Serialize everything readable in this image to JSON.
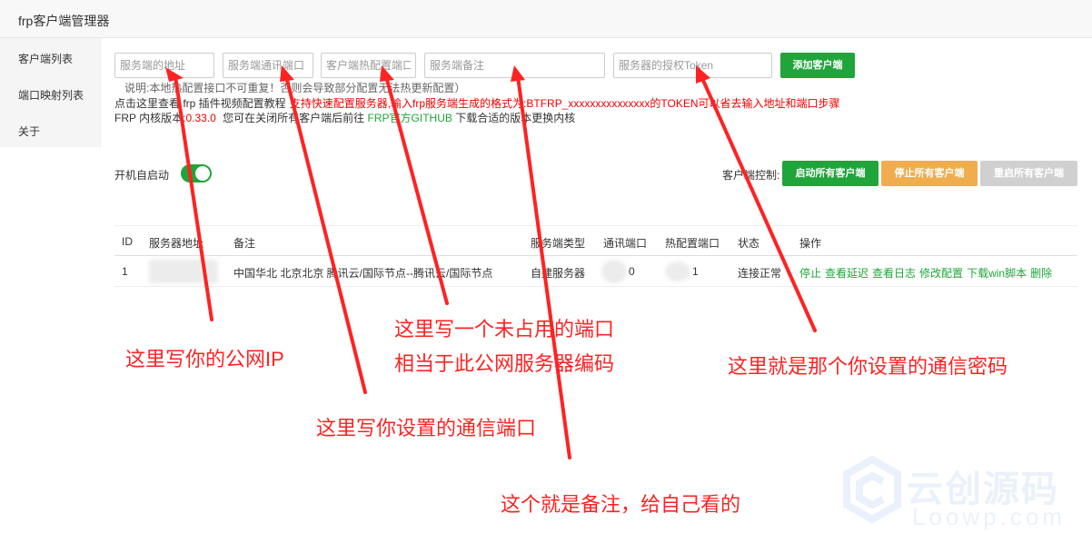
{
  "window": {
    "title": "frp客户端管理器"
  },
  "sidebar": {
    "items": [
      {
        "label": "客户端列表"
      },
      {
        "label": "端口映射列表"
      },
      {
        "label": "关于"
      }
    ]
  },
  "form": {
    "server_addr_placeholder": "服务端的地址",
    "server_port_placeholder": "服务端通讯端口",
    "client_port_placeholder": "客户端热配置端口",
    "remark_placeholder": "服务端备注",
    "token_placeholder": "服务器的授权Token",
    "add_button": "添加客户端"
  },
  "notes": {
    "line1": "说明:本地热配置接口不可重复！否则会导致部分配置无法热更新配置）",
    "line2_a": "点击这里查看 frp 插件视频配置教程",
    "line2_b": "支持快速配置服务器,输入frp服务端生成的格式为:BTFRP_xxxxxxxxxxxxxxx的TOKEN可以省去输入地址和端口步骤",
    "line3_a": "FRP 内核版本:",
    "line3_version": "0.33.0",
    "line3_b": "您可在关闭所有客户端后前往",
    "line3_link": "FRP官方GITHUB",
    "line3_c": "下载合适的版本更换内核"
  },
  "autostart": {
    "label": "开机自启动",
    "enabled": true
  },
  "control": {
    "label": "客户端控制:",
    "start_all": "启动所有客户端",
    "stop_all": "停止所有客户端",
    "restart_all": "重启所有客户端"
  },
  "table": {
    "headers": [
      "ID",
      "服务器地址",
      "备注",
      "服务端类型",
      "通讯端口",
      "热配置端口",
      "状态",
      "操作"
    ],
    "rows": [
      {
        "id": "1",
        "remark": "中国华北 北京北京 腾讯云/国际节点--腾讯云/国际节点",
        "server_type": "自建服务器",
        "port_suffix": "0",
        "hot_port_suffix": "1",
        "status": "连接正常",
        "actions": [
          "停止",
          "查看延迟",
          "查看日志",
          "修改配置",
          "下载win脚本",
          "删除"
        ]
      }
    ]
  },
  "annotations": {
    "public_ip": "这里写你的公网IP",
    "comm_port": "这里写你设置的通信端口",
    "unused_port_1": "这里写一个未占用的端口",
    "unused_port_2": "相当于此公网服务器编码",
    "remark": "这个就是备注，给自己看的",
    "token": "这里就是那个你设置的通信密码"
  },
  "watermark": {
    "text": "云创源码",
    "sub": "Loowp.com"
  },
  "colors": {
    "accent_green": "#20a53a",
    "warn_orange": "#f0ad4e",
    "annotation_red": "#ff2222"
  }
}
